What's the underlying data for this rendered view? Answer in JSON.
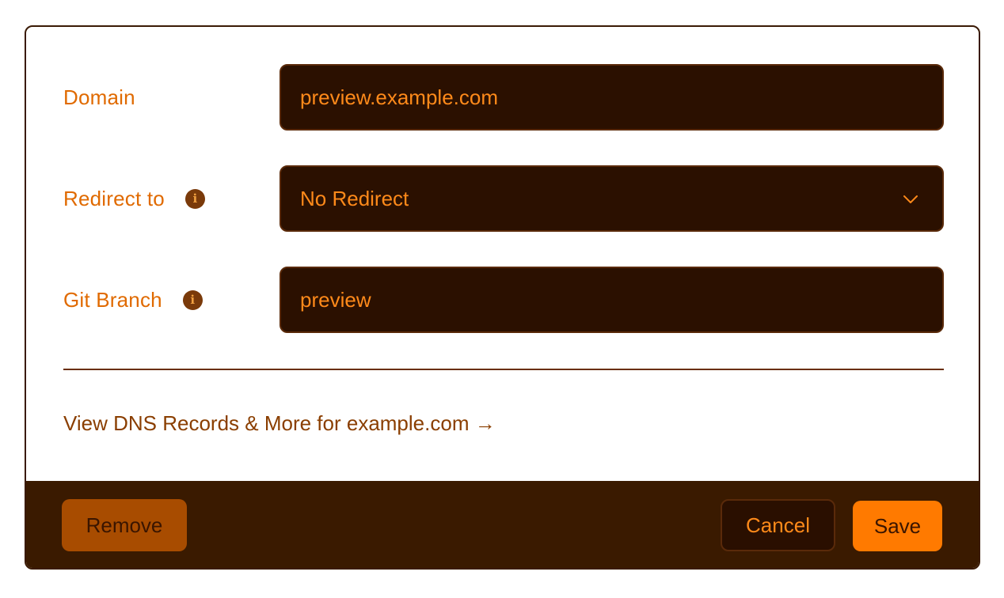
{
  "form": {
    "domain": {
      "label": "Domain",
      "value": "preview.example.com"
    },
    "redirect": {
      "label": "Redirect to",
      "info_icon": "info-icon",
      "selected": "No Redirect",
      "dropdown_icon": "chevron-down-icon"
    },
    "git_branch": {
      "label": "Git Branch",
      "info_icon": "info-icon",
      "value": "preview"
    },
    "info_glyph": "i"
  },
  "dns_link": {
    "text": "View DNS Records & More for example.com →"
  },
  "footer": {
    "remove_label": "Remove",
    "cancel_label": "Cancel",
    "save_label": "Save"
  },
  "colors": {
    "accent": "#ff7a00",
    "label_text": "#e06a00",
    "field_bg": "#2b1000",
    "footer_bg": "#3a1a00",
    "remove_bg": "#a84c00",
    "link_text": "#8a3e00"
  }
}
